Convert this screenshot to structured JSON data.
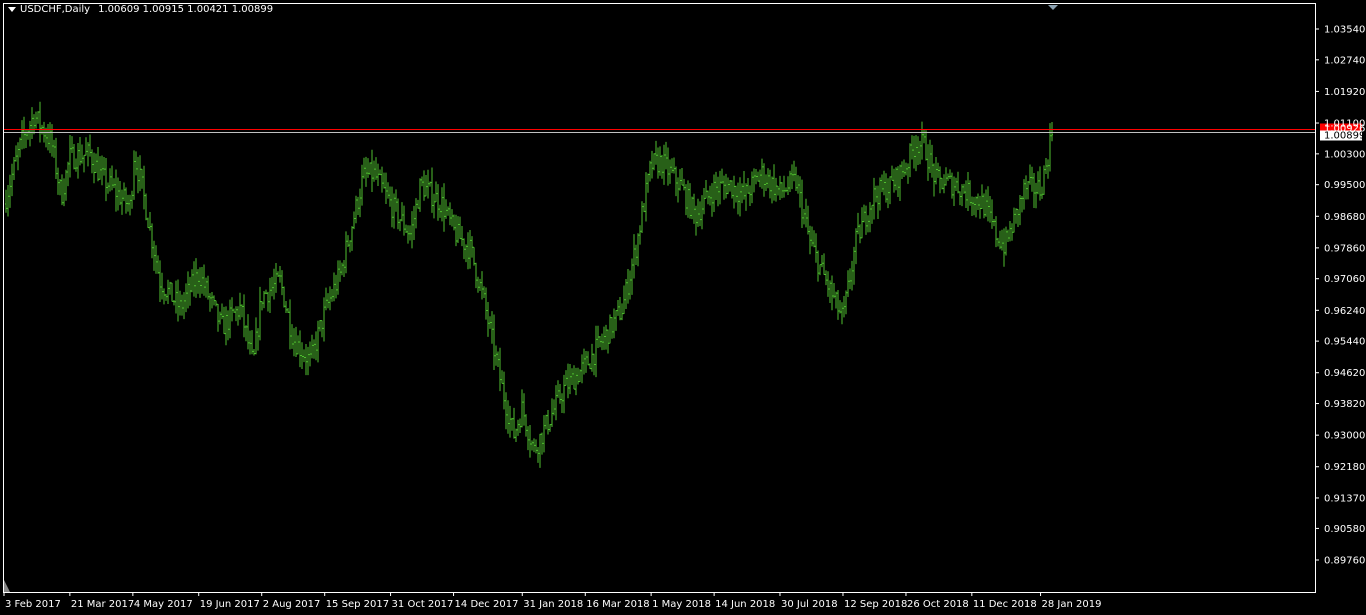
{
  "header": {
    "symbol": "USDCHF,Daily",
    "ohlc": "1.00609 1.00915 1.00421 1.00899"
  },
  "colors": {
    "background": "#000000",
    "foreground": "#ffffff",
    "bars": "#4fbf2f",
    "ask_line": "#ff0000",
    "bid_line": "#c0c0c0",
    "ask_label_bg": "#ff0000",
    "bid_label_bg": "#ffffff"
  },
  "price_labels": {
    "ask": "1.00926",
    "bid": "1.00899"
  },
  "chart_data": {
    "type": "bar",
    "title": "USDCHF,Daily",
    "grid": false,
    "ylim": [
      0.8976,
      1.0394
    ],
    "y_ticks": [
      "1.03540",
      "1.02740",
      "1.01920",
      "1.01100",
      "1.00300",
      "0.99500",
      "0.98680",
      "0.97860",
      "0.97060",
      "0.96240",
      "0.95440",
      "0.94620",
      "0.93820",
      "0.93000",
      "0.92180",
      "0.91370",
      "0.90580",
      "0.89760"
    ],
    "x_ticks": [
      "3 Feb 2017",
      "21 Mar 2017",
      "4 May 2017",
      "19 Jun 2017",
      "2 Aug 2017",
      "15 Sep 2017",
      "31 Oct 2017",
      "14 Dec 2017",
      "31 Jan 2018",
      "16 Mar 2018",
      "1 May 2018",
      "14 Jun 2018",
      "30 Jul 2018",
      "12 Sep 2018",
      "26 Oct 2018",
      "11 Dec 2018",
      "28 Jan 2019"
    ],
    "ask": 1.00926,
    "bid": 1.00899,
    "series": [
      {
        "close_path": [
          [
            "3 Feb 2017",
            0.99
          ],
          [
            "15 Feb 2017",
            1.006
          ],
          [
            "24 Feb 2017",
            1.013
          ],
          [
            "8 Mar 2017",
            1.006
          ],
          [
            "15 Mar 2017",
            0.992
          ],
          [
            "21 Mar 2017",
            1.002
          ],
          [
            "4 Apr 2017",
            1.003
          ],
          [
            "12 Apr 2017",
            0.997
          ],
          [
            "3 May 2017",
            0.989
          ],
          [
            "4 May 2017",
            1.004
          ],
          [
            "10 May 2017",
            0.995
          ],
          [
            "23 May 2017",
            0.97
          ],
          [
            "6 Jun 2017",
            0.963
          ],
          [
            "19 Jun 2017",
            0.972
          ],
          [
            "5 Jul 2017",
            0.958
          ],
          [
            "18 Jul 2017",
            0.963
          ],
          [
            "27 Jul 2017",
            0.948
          ],
          [
            "2 Aug 2017",
            0.966
          ],
          [
            "15 Aug 2017",
            0.97
          ],
          [
            "24 Aug 2017",
            0.955
          ],
          [
            "5 Sep 2017",
            0.949
          ],
          [
            "15 Sep 2017",
            0.962
          ],
          [
            "26 Sep 2017",
            0.972
          ],
          [
            "12 Oct 2017",
            0.997
          ],
          [
            "19 Oct 2017",
            0.998
          ],
          [
            "31 Oct 2017",
            0.99
          ],
          [
            "14 Nov 2017",
            0.982
          ],
          [
            "21 Nov 2017",
            0.995
          ],
          [
            "6 Dec 2017",
            0.99
          ],
          [
            "14 Dec 2017",
            0.983
          ],
          [
            "26 Dec 2017",
            0.978
          ],
          [
            "4 Jan 2018",
            0.965
          ],
          [
            "17 Jan 2018",
            0.942
          ],
          [
            "25 Jan 2018",
            0.93
          ],
          [
            "31 Jan 2018",
            0.937
          ],
          [
            "8 Feb 2018",
            0.926
          ],
          [
            "20 Feb 2018",
            0.935
          ],
          [
            "1 Mar 2018",
            0.942
          ],
          [
            "16 Mar 2018",
            0.948
          ],
          [
            "29 Mar 2018",
            0.955
          ],
          [
            "11 Apr 2018",
            0.963
          ],
          [
            "20 Apr 2018",
            0.978
          ],
          [
            "1 May 2018",
            1.0
          ],
          [
            "8 May 2018",
            1.001
          ],
          [
            "21 May 2018",
            0.995
          ],
          [
            "1 Jun 2018",
            0.987
          ],
          [
            "14 Jun 2018",
            0.994
          ],
          [
            "25 Jun 2018",
            0.995
          ],
          [
            "5 Jul 2018",
            0.992
          ],
          [
            "17 Jul 2018",
            0.998
          ],
          [
            "30 Jul 2018",
            0.993
          ],
          [
            "10 Aug 2018",
            0.996
          ],
          [
            "20 Aug 2018",
            0.98
          ],
          [
            "31 Aug 2018",
            0.97
          ],
          [
            "12 Sep 2018",
            0.96
          ],
          [
            "21 Sep 2018",
            0.98
          ],
          [
            "3 Oct 2018",
            0.992
          ],
          [
            "16 Oct 2018",
            0.995
          ],
          [
            "26 Oct 2018",
            1.0
          ],
          [
            "2 Nov 2018",
            1.006
          ],
          [
            "8 Nov 2018",
            1.005
          ],
          [
            "16 Nov 2018",
            0.996
          ],
          [
            "30 Nov 2018",
            0.995
          ],
          [
            "11 Dec 2018",
            0.992
          ],
          [
            "19 Dec 2018",
            0.99
          ],
          [
            "28 Dec 2018",
            0.982
          ],
          [
            "3 Jan 2019",
            0.979
          ],
          [
            "10 Jan 2019",
            0.986
          ],
          [
            "17 Jan 2019",
            0.994
          ],
          [
            "28 Jan 2019",
            0.994
          ],
          [
            "1 Feb 2019",
            1.0
          ],
          [
            "5 Feb 2019",
            1.009
          ]
        ]
      }
    ]
  }
}
